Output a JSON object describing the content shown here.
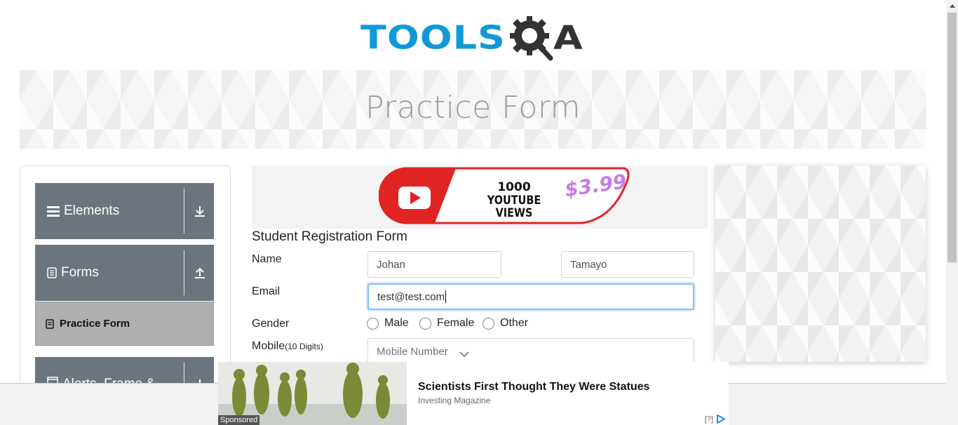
{
  "logo": {
    "brand_left": "TOOLS",
    "brand_right": "A"
  },
  "banner": {
    "title": "Practice Form"
  },
  "sidebar": {
    "groups": [
      {
        "label": "Elements",
        "icon": "hamburger-icon",
        "arrow": "download-icon"
      },
      {
        "label": "Forms",
        "icon": "document-icon",
        "arrow": "upload-icon"
      },
      {
        "label": "Alerts, Frame &",
        "icon": "window-icon",
        "arrow": "download-icon"
      }
    ],
    "active_item": {
      "label": "Practice Form",
      "icon": "document-icon"
    }
  },
  "top_ad": {
    "line1": "1000",
    "line2": "YOUTUBE VIEWS",
    "price": "$3.99"
  },
  "form": {
    "title": "Student Registration Form",
    "name_label": "Name",
    "first_name_value": "Johan",
    "last_name_value": "Tamayo",
    "email_label": "Email",
    "email_value": "test@test.com",
    "gender_label": "Gender",
    "gender_options": [
      "Male",
      "Female",
      "Other"
    ],
    "mobile_label": "Mobile",
    "mobile_hint": "(10 Digits)",
    "mobile_placeholder": "Mobile Number"
  },
  "sticky_ad": {
    "headline": "Scientists First Thought They Were Statues",
    "source": "Investing Magazine",
    "sponsored": "Sponsored",
    "info": "[?]"
  },
  "colors": {
    "brand_blue": "#0f9ad7",
    "sidebar_gray": "#6c757d",
    "active_gray": "#b0b0b0",
    "focus_blue": "#80bdff"
  }
}
